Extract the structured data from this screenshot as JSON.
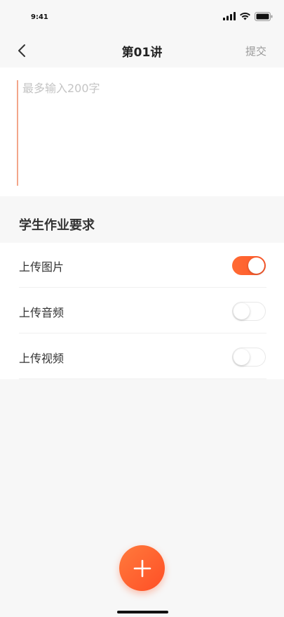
{
  "status_bar": {
    "time": "9:41"
  },
  "nav": {
    "title": "第01讲",
    "submit_label": "提交"
  },
  "input": {
    "placeholder": "最多输入200字",
    "value": ""
  },
  "requirements": {
    "heading": "学生作业要求",
    "items": [
      {
        "label": "上传图片",
        "enabled": true
      },
      {
        "label": "上传音频",
        "enabled": false
      },
      {
        "label": "上传视频",
        "enabled": false
      }
    ]
  },
  "colors": {
    "accent": "#ff5a2c",
    "background": "#f7f7f7",
    "card": "#ffffff"
  },
  "icons": {
    "back": "chevron-left-icon",
    "fab": "plus-icon"
  }
}
